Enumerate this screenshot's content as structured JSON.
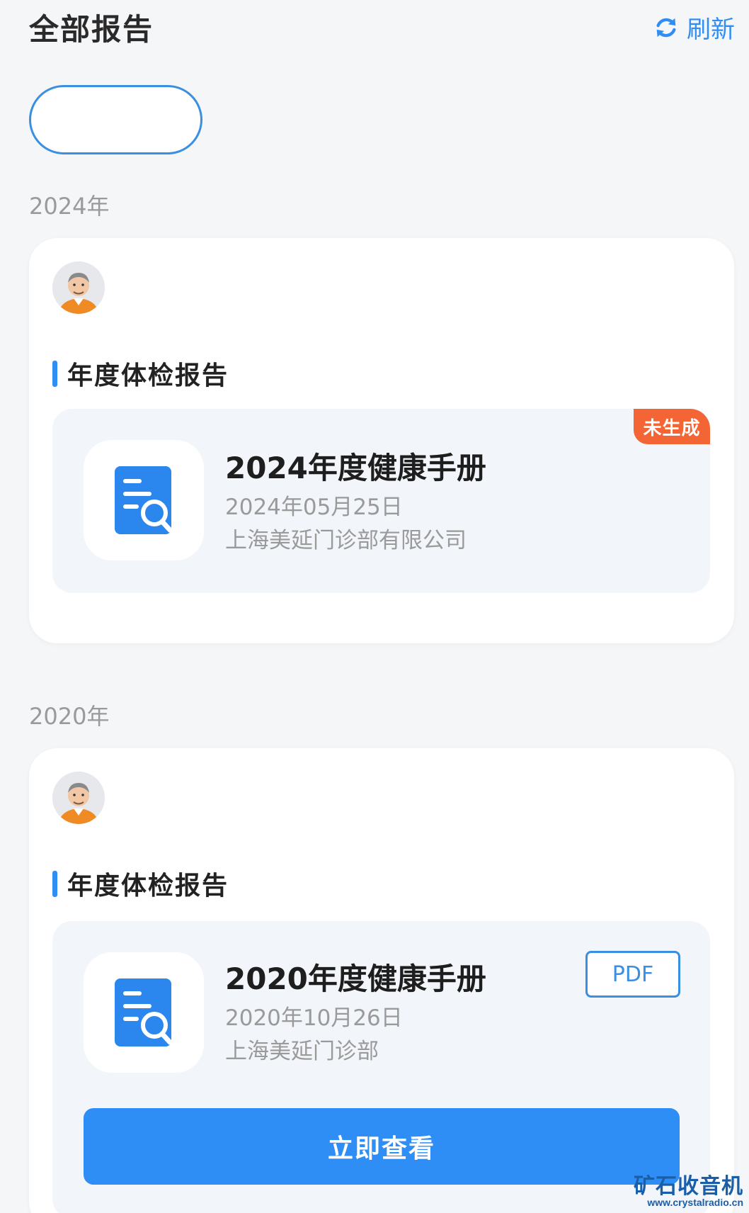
{
  "header": {
    "title": "全部报告",
    "refresh_label": "刷新",
    "refresh_icon": "refresh-icon",
    "accent_color": "#2f8ef5"
  },
  "selector": {
    "value": ""
  },
  "sections": [
    {
      "year_label": "2024年",
      "card": {
        "user_name": "",
        "section_title": "年度体检报告",
        "report": {
          "name": "2024年度健康手册",
          "date": "2024年05月25日",
          "org": "上海美延门诊部有限公司",
          "status_badge": "未生成",
          "status_color": "#f46535"
        }
      }
    },
    {
      "year_label": "2020年",
      "card": {
        "user_name": "",
        "section_title": "年度体检报告",
        "report": {
          "name": "2020年度健康手册",
          "date": "2020年10月26日",
          "org": "上海美延门诊部",
          "pdf_label": "PDF"
        },
        "view_button_label": "立即查看"
      }
    }
  ],
  "watermark": {
    "main": "矿石收音机",
    "url": "www.crystalradio.cn"
  }
}
